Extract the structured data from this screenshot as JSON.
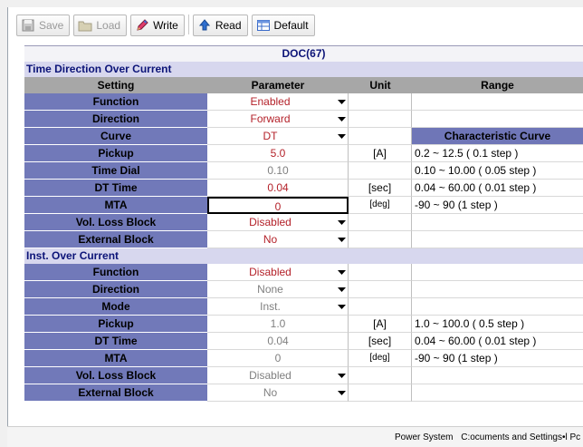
{
  "toolbar": {
    "save_label": "Save",
    "load_label": "Load",
    "write_label": "Write",
    "read_label": "Read",
    "default_label": "Default"
  },
  "title": "DOC(67)",
  "columns": {
    "setting": "Setting",
    "parameter": "Parameter",
    "unit": "Unit",
    "range": "Range"
  },
  "sections": [
    {
      "name": "Time Direction Over Current",
      "rows": [
        {
          "setting": "Function",
          "parameter": "Enabled",
          "unit": "",
          "range": ""
        },
        {
          "setting": "Direction",
          "parameter": "Forward",
          "unit": "",
          "range": ""
        },
        {
          "setting": "Curve",
          "parameter": "DT",
          "unit": "",
          "range": "Characteristic Curve"
        },
        {
          "setting": "Pickup",
          "parameter": "5.0",
          "unit": "[A]",
          "range": "0.2 ~ 12.5 ( 0.1 step )"
        },
        {
          "setting": "Time Dial",
          "parameter": "0.10",
          "unit": "",
          "range": "0.10 ~ 10.00 ( 0.05 step )"
        },
        {
          "setting": "DT Time",
          "parameter": "0.04",
          "unit": "[sec]",
          "range": "0.04 ~ 60.00 ( 0.01 step )"
        },
        {
          "setting": "MTA",
          "parameter": "0",
          "unit": "[deg]",
          "range": "-90 ~ 90 (1 step )"
        },
        {
          "setting": "Vol. Loss Block",
          "parameter": "Disabled",
          "unit": "",
          "range": ""
        },
        {
          "setting": "External Block",
          "parameter": "No",
          "unit": "",
          "range": ""
        }
      ]
    },
    {
      "name": "Inst. Over Current",
      "rows": [
        {
          "setting": "Function",
          "parameter": "Disabled",
          "unit": "",
          "range": ""
        },
        {
          "setting": "Direction",
          "parameter": "None",
          "unit": "",
          "range": ""
        },
        {
          "setting": "Mode",
          "parameter": "Inst.",
          "unit": "",
          "range": ""
        },
        {
          "setting": "Pickup",
          "parameter": "1.0",
          "unit": "[A]",
          "range": "1.0 ~ 100.0 ( 0.5 step )"
        },
        {
          "setting": "DT Time",
          "parameter": "0.04",
          "unit": "[sec]",
          "range": "0.04 ~ 60.00 ( 0.01 step )"
        },
        {
          "setting": "MTA",
          "parameter": "0",
          "unit": "[deg]",
          "range": "-90 ~ 90 (1 step )"
        },
        {
          "setting": "Vol. Loss Block",
          "parameter": "Disabled",
          "unit": "",
          "range": ""
        },
        {
          "setting": "External Block",
          "parameter": "No",
          "unit": "",
          "range": ""
        }
      ]
    }
  ],
  "status": {
    "left": "Power System",
    "right": "C:ocuments and Settings•l Pc"
  },
  "colors": {
    "setting_bg": "#7179b9",
    "section_bg": "#d7d7ee",
    "header_bg": "#a7a7a7",
    "title_text": "#0c1478",
    "enabled_text": "#b4222a"
  },
  "icons": {
    "save": "floppy-icon",
    "load": "folder-icon",
    "write": "pencil-icon",
    "read": "up-arrow-icon",
    "default": "table-icon",
    "dropdown": "chevron-down-icon"
  }
}
